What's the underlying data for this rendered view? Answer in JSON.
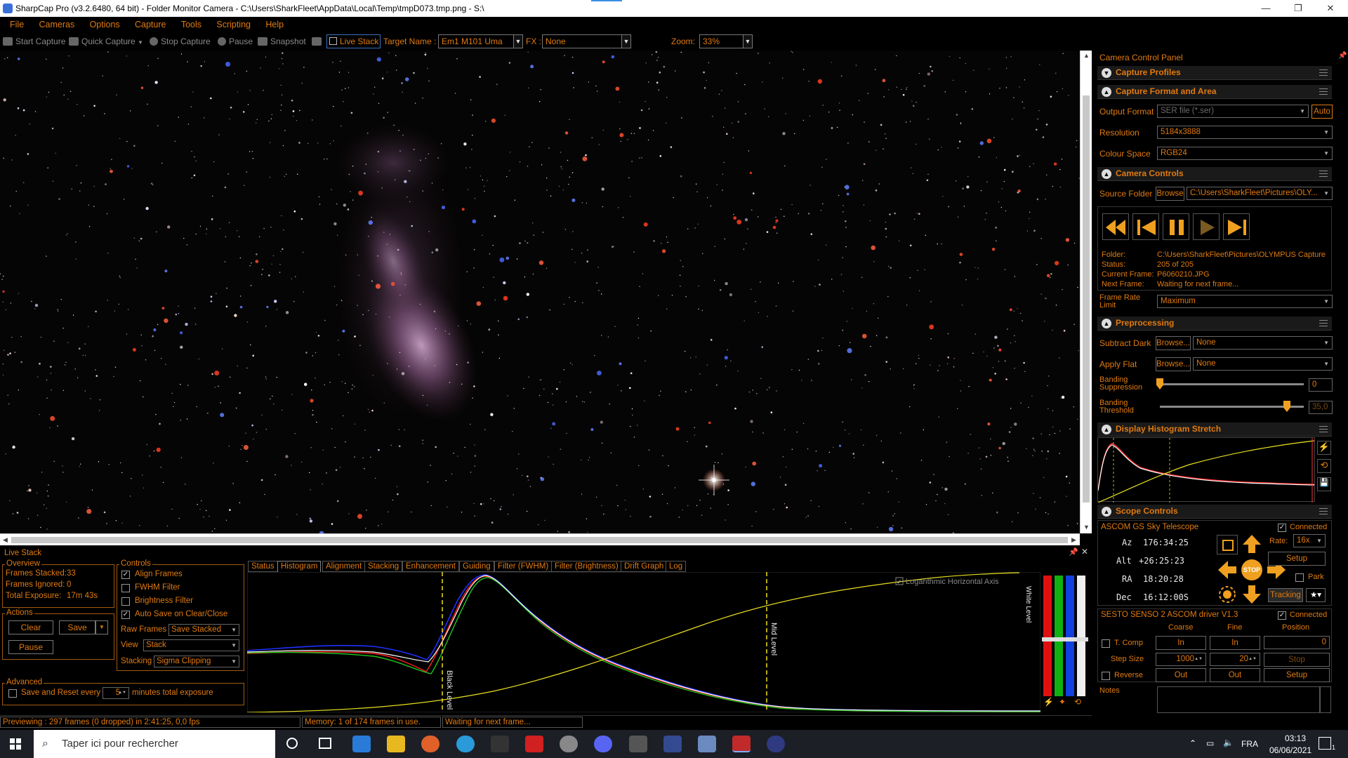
{
  "window": {
    "title": "SharpCap Pro (v3.2.6480, 64 bit) - Folder Monitor Camera - C:\\Users\\SharkFleet\\AppData\\Local\\Temp\\tmpD073.tmp.png - S:\\",
    "minimize": "—",
    "maximize": "❐",
    "close": "✕"
  },
  "menu": [
    "File",
    "Cameras",
    "Options",
    "Capture",
    "Tools",
    "Scripting",
    "Help"
  ],
  "toolbar": {
    "start_capture": "Start Capture",
    "quick_capture": "Quick Capture",
    "stop_capture": "Stop Capture",
    "pause": "Pause",
    "snapshot": "Snapshot",
    "live_stack": "Live Stack",
    "target_label": "Target Name :",
    "target_value": "Em1 M101 Uma",
    "fx_label": "FX :",
    "fx_value": "None",
    "zoom_label": "Zoom:",
    "zoom_value": "33%"
  },
  "livestack": {
    "header": "Live Stack",
    "overview": {
      "title": "Overview",
      "frames_stacked_label": "Frames Stacked:",
      "frames_stacked": "33",
      "frames_ignored_label": "Frames Ignored:",
      "frames_ignored": "0",
      "total_exposure_label": "Total Exposure:",
      "total_exposure": "17m 43s"
    },
    "actions": {
      "title": "Actions",
      "clear": "Clear",
      "save": "Save",
      "pause": "Pause"
    },
    "advanced": {
      "title": "Advanced",
      "save_reset_label": "Save and Reset every",
      "minutes_value": "5",
      "minutes_label": "minutes total exposure"
    },
    "controls": {
      "title": "Controls",
      "align_frames": "Align Frames",
      "fwhm_filter": "FWHM Filter",
      "brightness_filter": "Brightness Filter",
      "auto_save": "Auto Save on Clear/Close",
      "raw_frames_label": "Raw Frames",
      "raw_frames_value": "Save Stacked",
      "view_label": "View",
      "view_value": "Stack",
      "stacking_label": "Stacking",
      "stacking_value": "Sigma Clipping"
    },
    "tabs": [
      "Status",
      "Histogram",
      "Alignment",
      "Stacking",
      "Enhancement",
      "Guiding",
      "Filter (FWHM)",
      "Filter (Brightness)",
      "Drift Graph",
      "Log"
    ],
    "active_tab": "Histogram",
    "histogram": {
      "log_axis_label": "Logarithmic Horizontal Axis",
      "black_level": "Black Level",
      "mid_level": "Mid Level",
      "white_level": "White Level"
    }
  },
  "statusbar": {
    "preview": "Previewing : 297 frames (0 dropped) in 2:41:25, 0,0 fps",
    "memory": "Memory: 1 of 174 frames in use.",
    "waiting": "Waiting for next frame..."
  },
  "panel": {
    "title": "Camera Control Panel",
    "capture_profiles": "Capture Profiles",
    "capture_format": "Capture Format and Area",
    "output_format_label": "Output Format",
    "output_format_value": "SER file (*.ser)",
    "auto_label": "Auto",
    "resolution_label": "Resolution",
    "resolution_value": "5184x3888",
    "colour_space_label": "Colour Space",
    "colour_space_value": "RGB24",
    "camera_controls": "Camera Controls",
    "source_folder_label": "Source Folder",
    "browse": "Browse",
    "source_folder_value": "C:\\Users\\SharkFleet\\Pictures\\OLY...",
    "folder_label": "Folder:",
    "folder_value": "C:\\Users\\SharkFleet\\Pictures\\OLYMPUS Capture",
    "status_label": "Status:",
    "status_value": "205 of 205",
    "current_frame_label": "Current Frame:",
    "current_frame_value": "P6060210.JPG",
    "next_frame_label": "Next Frame:",
    "next_frame_value": "Waiting for next frame...",
    "frame_rate_label": "Frame Rate Limit",
    "frame_rate_value": "Maximum",
    "preprocessing": "Preprocessing",
    "subtract_dark_label": "Subtract Dark",
    "apply_flat_label": "Apply Flat",
    "browse_ellipsis": "Browse...",
    "dark_value": "None",
    "flat_value": "None",
    "banding_suppression_label": "Banding Suppression",
    "banding_suppression_value": "0",
    "banding_threshold_label": "Banding Threshold",
    "banding_threshold_value": "35,0",
    "histogram_stretch": "Display Histogram Stretch",
    "scope_controls": "Scope Controls",
    "scope_name": "ASCOM GS Sky Telescope",
    "connected": "Connected",
    "rate_label": "Rate:",
    "rate_value": "16x",
    "az_label": "Az",
    "az_value": "176:34:25",
    "alt_label": "Alt",
    "alt_value": "+26:25:23",
    "ra_label": "RA",
    "ra_value": "18:20:28",
    "dec_label": "Dec",
    "dec_value": "16:12:00S",
    "stop": "STOP",
    "setup": "Setup",
    "park": "Park",
    "tracking": "Tracking",
    "focuser_name": "SESTO SENSO 2 ASCOM driver V1.3",
    "coarse": "Coarse",
    "fine": "Fine",
    "position": "Position",
    "t_comp": "T. Comp",
    "in": "In",
    "out": "Out",
    "position_value": "0",
    "step_size_label": "Step Size",
    "coarse_step": "1000",
    "fine_step": "20",
    "stop_label": "Stop",
    "reverse": "Reverse",
    "notes": "Notes"
  },
  "taskbar": {
    "search_placeholder": "Taper ici pour rechercher",
    "lang": "FRA",
    "time": "03:13",
    "date": "06/06/2021",
    "notif_count": "1"
  },
  "colors": {
    "accent": "#e07a10",
    "background": "#000000",
    "histogram_red": "#ff2020",
    "histogram_green": "#20c020",
    "histogram_blue": "#2030ff",
    "level_line": "#f0e020"
  }
}
